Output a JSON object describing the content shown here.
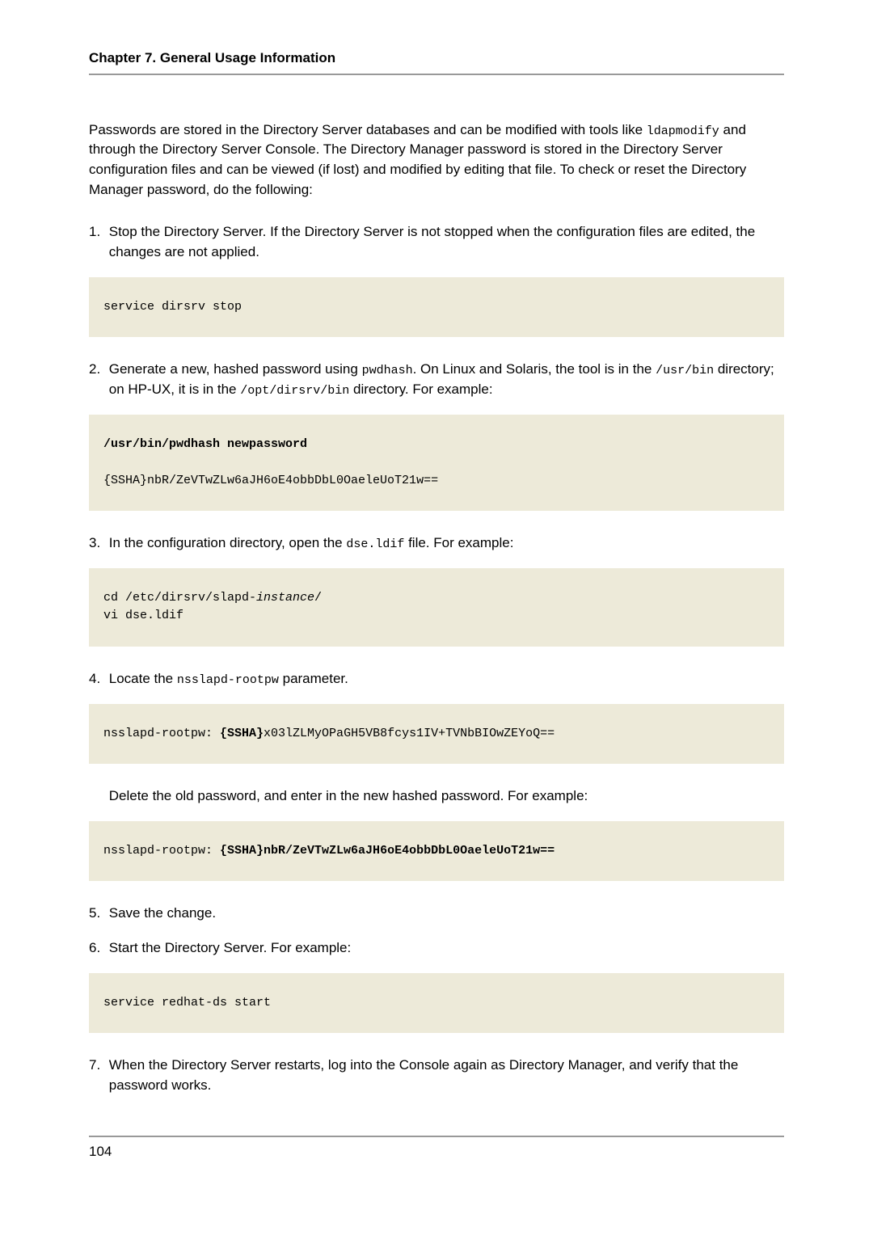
{
  "header": {
    "title": "Chapter 7. General Usage Information"
  },
  "intro": {
    "t1": "Passwords are stored in the Directory Server databases and can be modified with tools like ",
    "c1": "ldapmodify",
    "t2": " and through the Directory Server Console. The Directory Manager password is stored in the Directory Server configuration files and can be viewed (if lost) and modified by editing that file. To check or reset the Directory Manager password, do the following:"
  },
  "step1": {
    "num": "1.",
    "text": "Stop the Directory Server. If the Directory Server is not stopped when the configuration files are edited, the changes are not applied."
  },
  "code1": "service dirsrv stop",
  "step2": {
    "num": "2.",
    "t1": "Generate a new, hashed password using ",
    "c1": "pwdhash",
    "t2": ". On Linux and Solaris, the tool is in the ",
    "c2": "/usr/bin",
    "t3": " directory; on HP-UX, it is in the ",
    "c3": "/opt/dirsrv/bin",
    "t4": " directory. For example:"
  },
  "code2": {
    "bold": "/usr/bin/pwdhash newpassword",
    "rest": "{SSHA}nbR/ZeVTwZLw6aJH6oE4obbDbL0OaeleUoT21w=="
  },
  "step3": {
    "num": "3.",
    "t1": "In the configuration directory, open the ",
    "c1": "dse.ldif",
    "t2": " file. For example:"
  },
  "code3": {
    "l1a": "cd /etc/dirsrv/slapd-",
    "l1i": "instance",
    "l1b": "/",
    "l2": "vi dse.ldif"
  },
  "step4": {
    "num": "4.",
    "t1": "Locate the ",
    "c1": "nsslapd-rootpw",
    "t2": " parameter."
  },
  "code4": {
    "a": "nsslapd-rootpw: ",
    "b": "{SSHA}",
    "c": "x03lZLMyOPaGH5VB8fcys1IV+TVNbBIOwZEYoQ=="
  },
  "step4b": {
    "text": "Delete the old password, and enter in the new hashed password. For example:"
  },
  "code5": {
    "a": "nsslapd-rootpw: ",
    "b": "{SSHA}nbR/ZeVTwZLw6aJH6oE4obbDbL0OaeleUoT21w=="
  },
  "step5": {
    "num": "5.",
    "text": "Save the change."
  },
  "step6": {
    "num": "6.",
    "text": "Start the Directory Server. For example:"
  },
  "code6": "service redhat-ds start",
  "step7": {
    "num": "7.",
    "text": "When the Directory Server restarts, log into the Console again as Directory Manager, and verify that the password works."
  },
  "footer": {
    "page": "104"
  }
}
